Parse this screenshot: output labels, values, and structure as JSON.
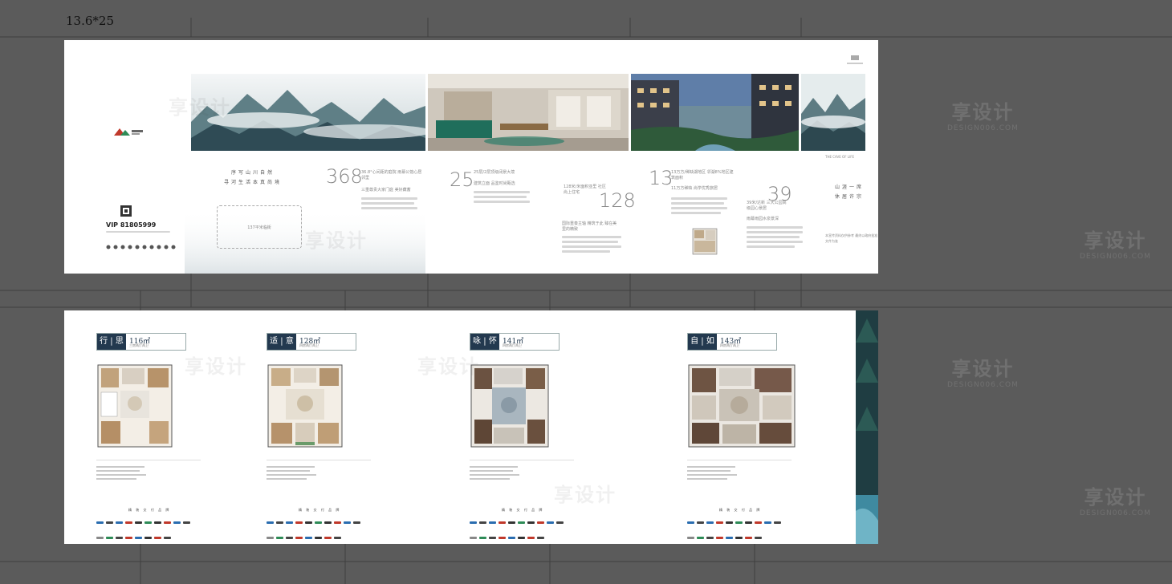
{
  "dimension_label": "13.6*25",
  "watermark": {
    "cn": "享设计",
    "en": "DESIGN006.COM"
  },
  "sheet1": {
    "hotline": "VIP 81805999",
    "left_slogan": [
      "序写山川自然",
      "寻河生活本真尚境"
    ],
    "field_label": "137平米临街",
    "stats": [
      {
        "num": "368",
        "sup": "㎡",
        "title": "36.8°心间距的庭院 雨幕公馆心居邻里",
        "sub": "三重尊贵大家门庭 美好藏蓄"
      },
      {
        "num": "25",
        "title": "25层/2层顶级阔景大境",
        "sub": "建筑立面 品鉴时尚甄选"
      },
      {
        "num": "128",
        "title": "128米/米面积亚里 社区尚上住宅",
        "sub": "国际重奏主轴 精筑于此 臻在美里的精致"
      },
      {
        "num": "13",
        "title": "13万方/稀缺湖地区 邻湖8%地区建筑面积",
        "sub": "11万方稀缺 尚学优秀旅居"
      },
      {
        "num": "39",
        "title": "39米/达新 三大公园高级园心景居",
        "sub": "雨幕雨园水泉景深"
      }
    ],
    "right_slogan": [
      "山涯一席",
      "休居许宗"
    ],
    "right_caption": "THE CAVE OF LIFE",
    "legal_note": "本宣传资料仅供参考 最终以政府批准文件为准"
  },
  "sheet2": {
    "plans": [
      {
        "name": "行 | 思",
        "area": "116㎡",
        "sub": "三房两厅两卫"
      },
      {
        "name": "适 | 意",
        "area": "128㎡",
        "sub": "四房两厅两卫"
      },
      {
        "name": "咏 | 怀",
        "area": "141㎡",
        "sub": "四房两厅两卫"
      },
      {
        "name": "自 | 如",
        "area": "143㎡",
        "sub": "四房两厅两卫"
      }
    ],
    "brands_title": "精 装 交 付 品 牌"
  },
  "colors": {
    "navy": "#23394f",
    "fog": "#c5d3d8",
    "forest": "#2f4b55",
    "background": "#5b5b5b"
  }
}
